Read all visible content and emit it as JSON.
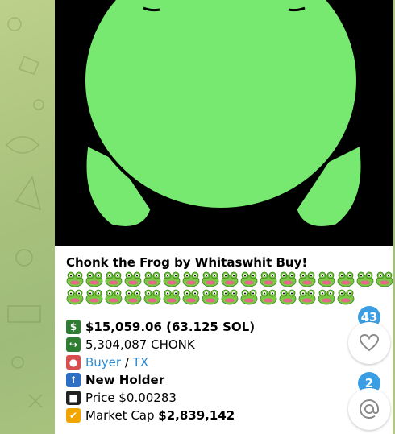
{
  "message": {
    "title": "Chonk the Frog by Whitaswhit Buy!",
    "frog_rows": [
      17,
      15
    ],
    "frog_icon": "frog-face-emoji",
    "lines": [
      {
        "icon": "dollar-icon",
        "color": "#2e7d32",
        "text": "$15,059.06 (63.125 SOL)",
        "bold": true
      },
      {
        "icon": "share-arrow-icon",
        "color": "#2e7d32",
        "text": "5,304,087 CHONK",
        "bold": false
      },
      {
        "icon": "person-icon",
        "color": "#d84e4e",
        "buyer": "Buyer",
        "sep": " / ",
        "tx": "TX"
      },
      {
        "icon": "up-arrow-icon",
        "color": "#2c6fc4",
        "text": "New Holder",
        "bold": true
      },
      {
        "icon": "stop-button-icon",
        "color": "#222222",
        "text": "Price $0.00283",
        "bold": false
      },
      {
        "icon": "check-mark-icon",
        "color": "#f0a500",
        "label": "Market Cap ",
        "value": "$2,839,142"
      }
    ]
  },
  "side": {
    "reactions_count": "43",
    "mentions_count": "2"
  },
  "colors": {
    "frog_green": "#77e870",
    "badge": "#3a9ee4",
    "link": "#2a8bd6"
  }
}
